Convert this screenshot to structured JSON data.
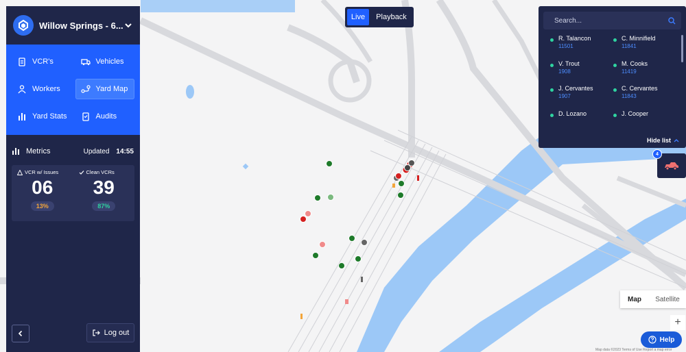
{
  "header": {
    "site_name": "Willow Springs - 6...",
    "logo_icon": "brand-logo-icon"
  },
  "nav": {
    "items": [
      {
        "label": "VCR's",
        "icon": "clipboard-icon",
        "active": false
      },
      {
        "label": "Vehicles",
        "icon": "truck-icon",
        "active": false
      },
      {
        "label": "Workers",
        "icon": "worker-icon",
        "active": false
      },
      {
        "label": "Yard Map",
        "icon": "map-route-icon",
        "active": true
      },
      {
        "label": "Yard Stats",
        "icon": "bar-chart-icon",
        "active": false
      },
      {
        "label": "Audits",
        "icon": "audit-clipboard-icon",
        "active": false
      }
    ]
  },
  "metrics": {
    "title": "Metrics",
    "updated_label": "Updated",
    "updated_time": "14:55",
    "issues": {
      "label": "VCR w/ Issues",
      "value": "06",
      "percent": "13%"
    },
    "clean": {
      "label": "Clean VCRs",
      "value": "39",
      "percent": "87%"
    }
  },
  "footer": {
    "logout_label": "Log out"
  },
  "mode": {
    "live_label": "Live",
    "playback_label": "Playback",
    "active": "live"
  },
  "list_panel": {
    "search_placeholder": "Search...",
    "workers": [
      {
        "name": "R. Talancon",
        "id": "11501"
      },
      {
        "name": "C. Minnifield",
        "id": "11841"
      },
      {
        "name": "V. Trout",
        "id": "1908"
      },
      {
        "name": "M. Cooks",
        "id": "11419"
      },
      {
        "name": "J. Cervantes",
        "id": "1907"
      },
      {
        "name": "C. Cervantes",
        "id": "11843"
      },
      {
        "name": "D. Lozano",
        "id": ""
      },
      {
        "name": "J. Cooper",
        "id": ""
      }
    ],
    "hide_label": "Hide list"
  },
  "truck_widget": {
    "badge_count": "4"
  },
  "map_controls": {
    "map_label": "Map",
    "satellite_label": "Satellite",
    "zoom_in": "+",
    "help_label": "Help",
    "attribution": "Map data ©2023   Terms of Use   Report a map error"
  },
  "colors": {
    "panel_bg": "#1f2649",
    "accent_blue": "#2060ff",
    "status_green": "#2fd3a0",
    "status_orange": "#f3a53a",
    "water": "#9cc8f7"
  },
  "markers": [
    {
      "type": "vehicle",
      "status": "green"
    },
    {
      "type": "vehicle",
      "status": "red"
    },
    {
      "type": "vehicle",
      "status": "grey"
    },
    {
      "type": "vehicle",
      "status": "pink"
    }
  ]
}
